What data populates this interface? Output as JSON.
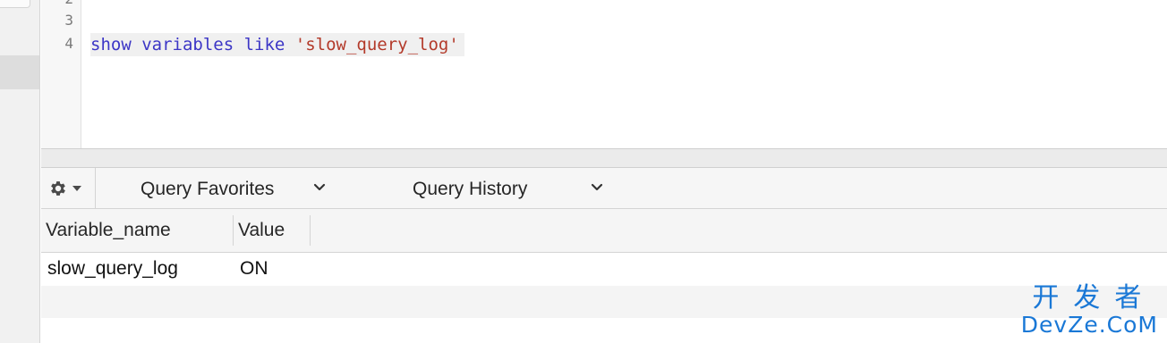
{
  "editor": {
    "line_numbers": [
      "2",
      "3",
      "4"
    ],
    "code": {
      "keyword_part": "show variables like ",
      "string_part": "'slow_query_log'"
    }
  },
  "toolbar": {
    "query_favorites_label": "Query Favorites",
    "query_history_label": "Query History"
  },
  "results": {
    "columns": [
      "Variable_name",
      "Value"
    ],
    "rows": [
      [
        "slow_query_log",
        "ON"
      ]
    ]
  },
  "watermark": {
    "line1": "开发者",
    "line2": "DevZe.CoM"
  },
  "colors": {
    "keyword": "#3c36c6",
    "string": "#b33a2a",
    "watermark": "#1a78d6"
  }
}
